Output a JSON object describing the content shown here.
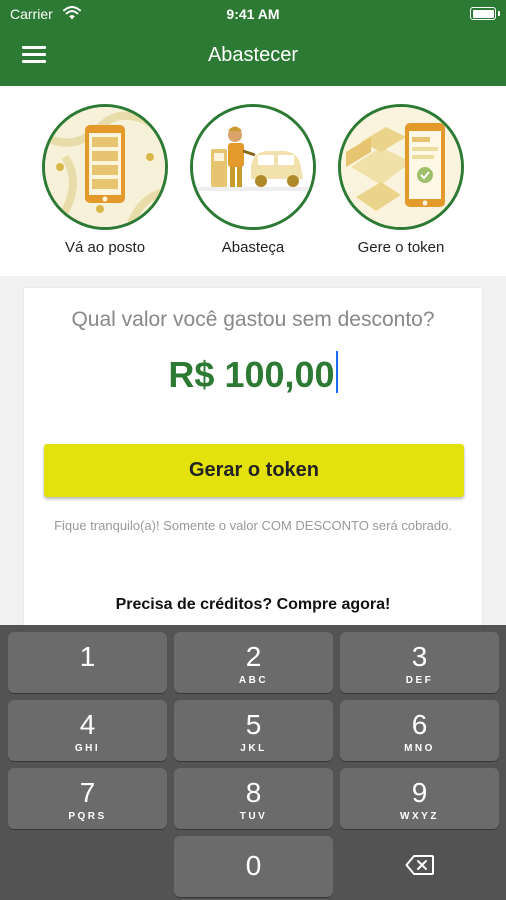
{
  "status_bar": {
    "carrier": "Carrier",
    "time": "9:41 AM"
  },
  "header": {
    "title": "Abastecer"
  },
  "steps": [
    {
      "label": "Vá ao posto"
    },
    {
      "label": "Abasteça"
    },
    {
      "label": "Gere o token"
    }
  ],
  "form": {
    "question": "Qual valor você gastou sem desconto?",
    "amount": "R$ 100,00",
    "generate_button": "Gerar o token",
    "note": "Fique tranquilo(a)! Somente o valor COM DESCONTO será cobrado.",
    "buy_credits": "Precisa de créditos? Compre agora!"
  },
  "keypad": [
    {
      "digit": "1",
      "letters": ""
    },
    {
      "digit": "2",
      "letters": "ABC"
    },
    {
      "digit": "3",
      "letters": "DEF"
    },
    {
      "digit": "4",
      "letters": "GHI"
    },
    {
      "digit": "5",
      "letters": "JKL"
    },
    {
      "digit": "6",
      "letters": "MNO"
    },
    {
      "digit": "7",
      "letters": "PQRS"
    },
    {
      "digit": "8",
      "letters": "TUV"
    },
    {
      "digit": "9",
      "letters": "WXYZ"
    },
    {
      "digit": "0",
      "letters": ""
    }
  ],
  "icons": [
    "menu-icon",
    "wifi-icon",
    "battery-icon",
    "backspace-icon"
  ],
  "colors": {
    "primary": "#2c7a34",
    "button": "#e3e20c",
    "keyboard": "#535353",
    "key": "#6b6b6b"
  }
}
